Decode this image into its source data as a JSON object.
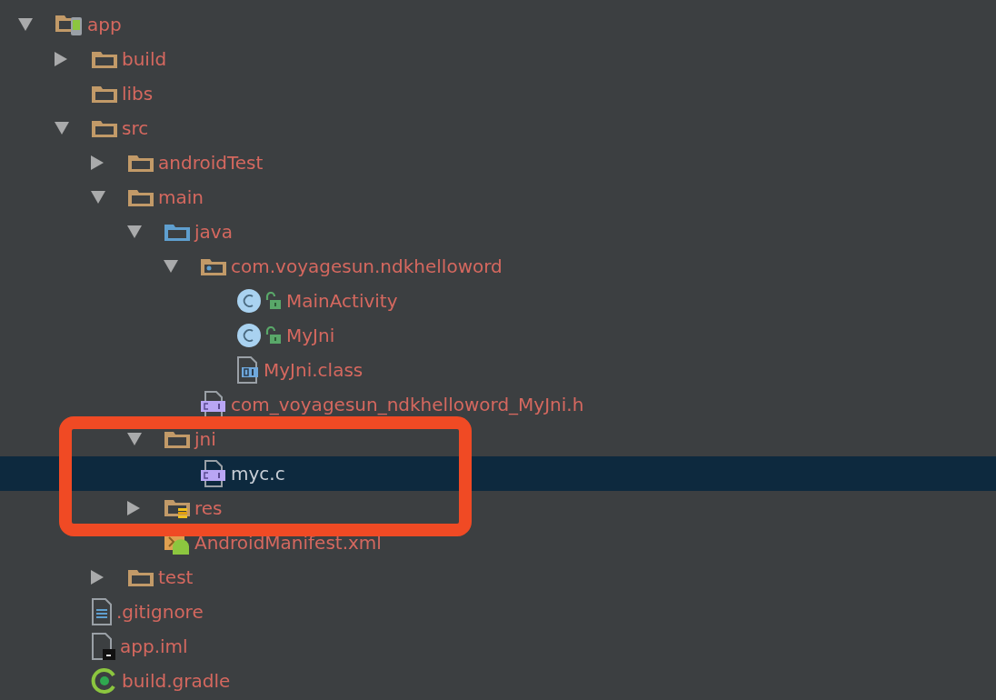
{
  "tree": [
    {
      "name": "app",
      "kind": "module",
      "expanded": true,
      "selected": false,
      "children": [
        {
          "name": "build",
          "kind": "folder",
          "expanded": false,
          "selected": false
        },
        {
          "name": "libs",
          "kind": "folder",
          "selected": false
        },
        {
          "name": "src",
          "kind": "folder",
          "expanded": true,
          "selected": false,
          "children": [
            {
              "name": "androidTest",
              "kind": "folder",
              "expanded": false,
              "selected": false
            },
            {
              "name": "main",
              "kind": "folder",
              "expanded": true,
              "selected": false,
              "children": [
                {
                  "name": "java",
                  "kind": "source-folder",
                  "expanded": true,
                  "selected": false,
                  "children": [
                    {
                      "name": "com.voyagesun.ndkhelloword",
                      "kind": "package",
                      "expanded": true,
                      "selected": false,
                      "children": [
                        {
                          "name": "MainActivity",
                          "kind": "class",
                          "selected": false
                        },
                        {
                          "name": "MyJni",
                          "kind": "class",
                          "selected": false
                        },
                        {
                          "name": "MyJni.class",
                          "kind": "binary",
                          "selected": false
                        }
                      ]
                    },
                    {
                      "name": "com_voyagesun_ndkhelloword_MyJni.h",
                      "kind": "c-file",
                      "selected": false
                    }
                  ]
                },
                {
                  "name": "jni",
                  "kind": "folder",
                  "expanded": true,
                  "selected": false,
                  "children": [
                    {
                      "name": "myc.c",
                      "kind": "c-file",
                      "selected": true
                    }
                  ]
                },
                {
                  "name": "res",
                  "kind": "resource-folder",
                  "expanded": false,
                  "selected": false
                },
                {
                  "name": "AndroidManifest.xml",
                  "kind": "manifest",
                  "selected": false
                }
              ]
            },
            {
              "name": "test",
              "kind": "folder",
              "expanded": false,
              "selected": false
            }
          ]
        },
        {
          "name": ".gitignore",
          "kind": "text",
          "selected": false
        },
        {
          "name": "app.iml",
          "kind": "module-file",
          "selected": false
        },
        {
          "name": "build.gradle",
          "kind": "gradle",
          "selected": false
        }
      ]
    }
  ]
}
